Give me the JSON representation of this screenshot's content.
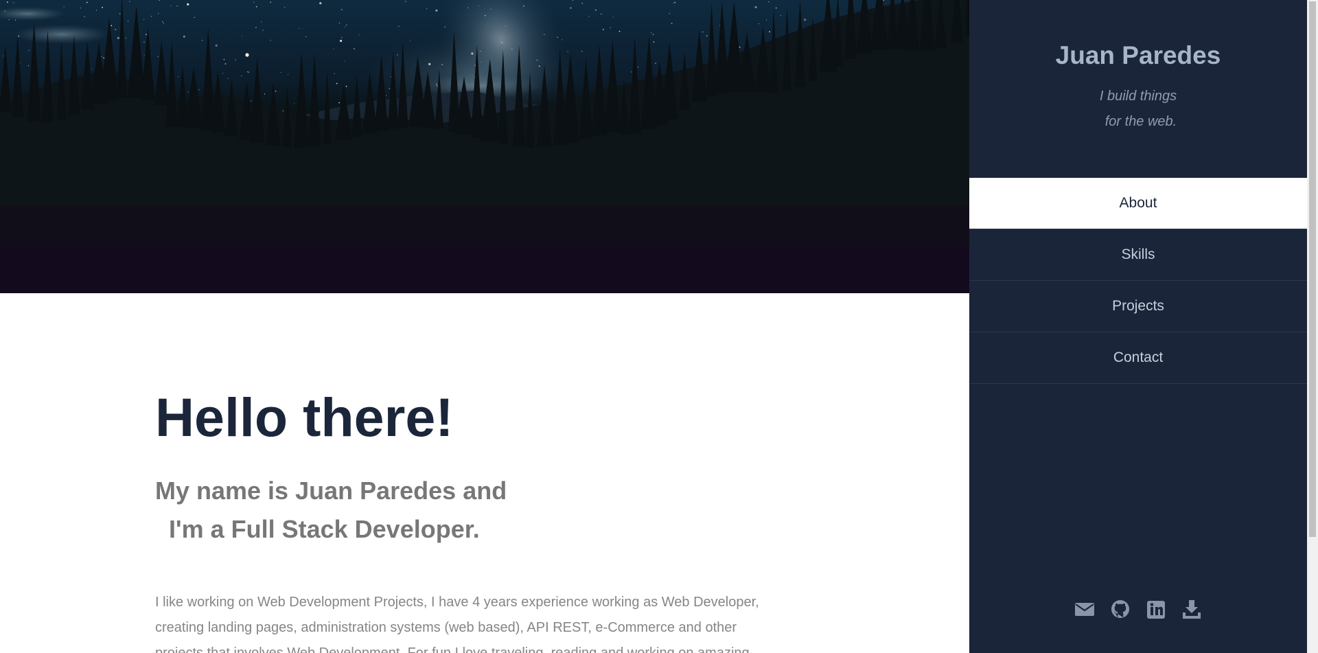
{
  "hero": {
    "image": "night-sky-forest-photo"
  },
  "main": {
    "greeting": "Hello there!",
    "intro": [
      "My name is Juan Paredes and",
      "I'm a Full Stack Developer."
    ],
    "bio": [
      "I like working on Web Development Projects, I have 4 years experience working as Web Developer,",
      "creating landing pages, administration systems (web based), API REST, e-Commerce and other",
      "projects that involves Web Development. For fun I love traveling, reading and working on amazing"
    ]
  },
  "sidebar": {
    "name": "Juan Paredes",
    "tagline": [
      "I build things",
      "for the web."
    ],
    "nav": [
      {
        "label": "About",
        "active": true
      },
      {
        "label": "Skills",
        "active": false
      },
      {
        "label": "Projects",
        "active": false
      },
      {
        "label": "Contact",
        "active": false
      }
    ],
    "socials": [
      "email-icon",
      "github-icon",
      "linkedin-icon",
      "download-icon"
    ]
  },
  "colors": {
    "sidebar_bg": "#1b253a",
    "heading": "#1b263b",
    "intro": "#777777",
    "body_text": "#858585",
    "nav_text": "#c7d0dc",
    "icon": "#8a96a8"
  }
}
